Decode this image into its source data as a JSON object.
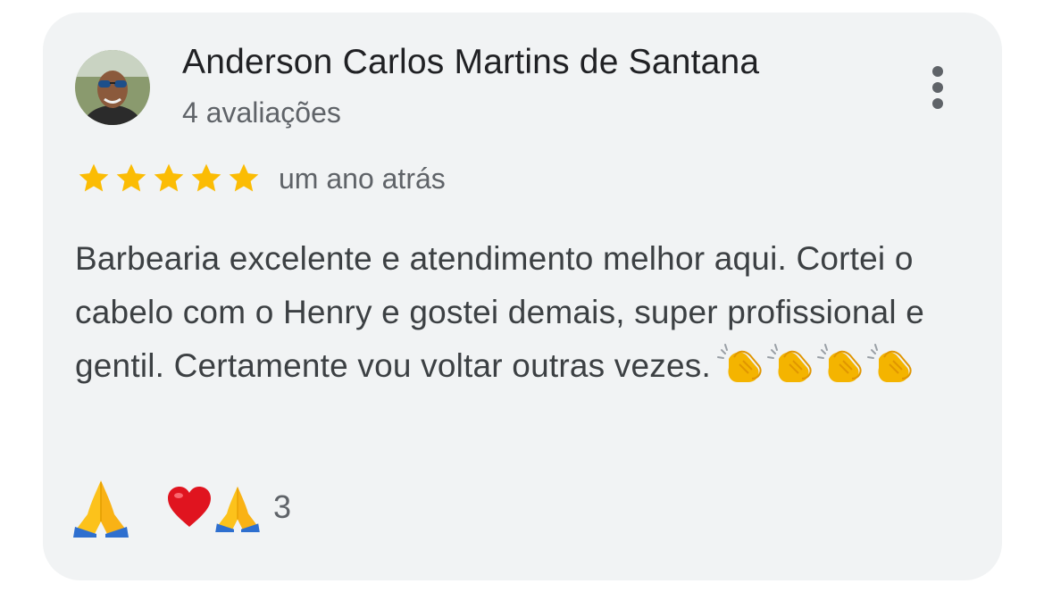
{
  "review": {
    "reviewer_name": "Anderson Carlos Martins de Santana",
    "reviewer_meta": "4 avaliações",
    "rating": 5,
    "rating_max": 5,
    "date": "um ano atrás",
    "text": "Barbearia excelente e atendimento melhor aqui. Cortei o cabelo com o Henry e gostei demais, super profissional e gentil. Certamente vou voltar outras vezes.",
    "emojis": [
      "clapping-hands",
      "clapping-hands",
      "clapping-hands",
      "clapping-hands"
    ]
  },
  "reactions": {
    "own_reaction": "folded-hands",
    "summary_emojis": [
      "red-heart",
      "folded-hands"
    ],
    "count": "3"
  },
  "colors": {
    "card_background": "#f1f3f4",
    "star": "#fbbc04",
    "name_text": "#202124",
    "secondary_text": "#5f6368",
    "body_text": "#3c4043"
  },
  "icons": {
    "more_menu": "more-vert-icon"
  }
}
